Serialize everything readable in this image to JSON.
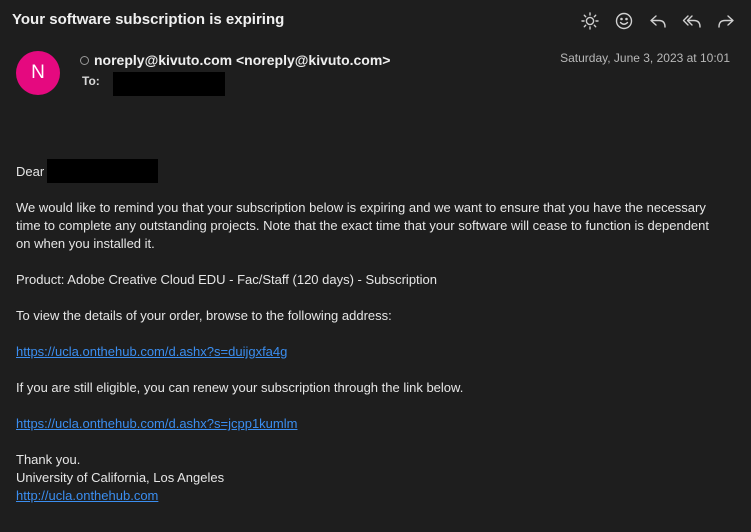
{
  "header": {
    "subject": "Your software subscription is expiring"
  },
  "toolbar": {
    "icons": [
      "brightness-icon",
      "smiley-icon",
      "reply-icon",
      "reply-all-icon",
      "forward-icon"
    ]
  },
  "sender": {
    "avatar_letter": "N",
    "avatar_color": "#e5097f",
    "from": "noreply@kivuto.com <noreply@kivuto.com>",
    "to_label": "To:",
    "date": "Saturday, June 3, 2023 at 10:01"
  },
  "message": {
    "greeting": "Dear",
    "paragraph1": "We would like to remind you that your subscription below is expiring and we want to ensure that you have the necessary time to complete any outstanding projects. Note that the exact time that your software will cease to function is dependent on when you installed it.",
    "product": "Product: Adobe Creative Cloud EDU - Fac/Staff (120 days) - Subscription",
    "view_details": "To view the details of your order, browse to the following address:",
    "order_link": "https://ucla.onthehub.com/d.ashx?s=duijgxfa4g",
    "renew_text": "If you are still eligible, you can renew your subscription through the link below.",
    "renew_link": "https://ucla.onthehub.com/d.ashx?s=jcpp1kumlm",
    "thanks": "Thank you.",
    "org": "University of California, Los Angeles",
    "site_link": "http://ucla.onthehub.com"
  },
  "colors": {
    "background": "#1e1e1e",
    "link": "#3b8ef0",
    "avatar": "#e5097f"
  }
}
